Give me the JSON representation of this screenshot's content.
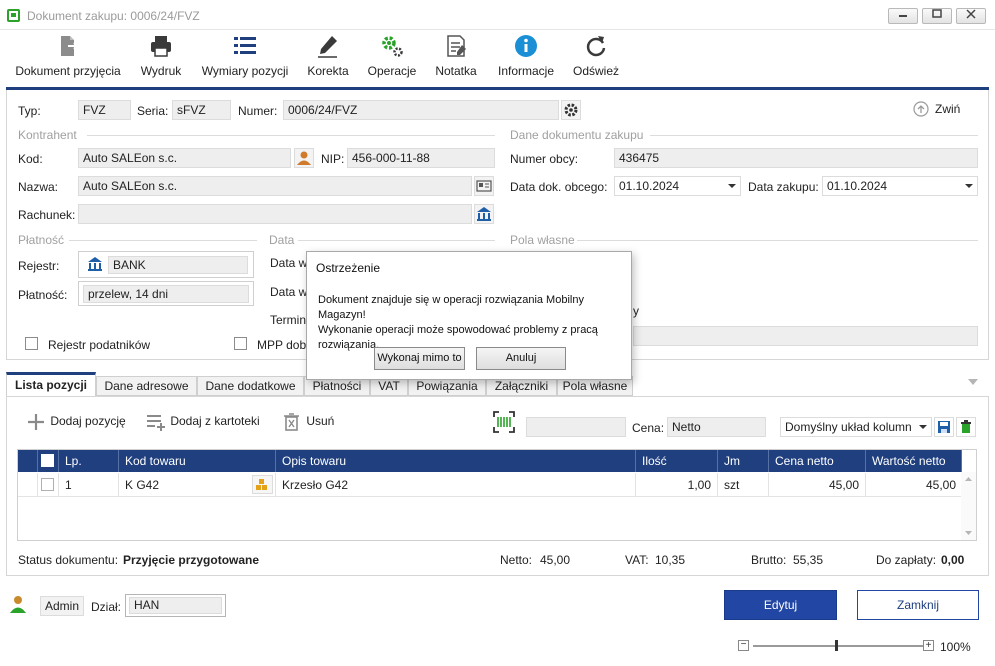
{
  "window": {
    "title": "Dokument zakupu: 0006/24/FVZ"
  },
  "toolbar": {
    "items": [
      {
        "label": "Dokument przyjęcia"
      },
      {
        "label": "Wydruk"
      },
      {
        "label": "Wymiary pozycji"
      },
      {
        "label": "Korekta"
      },
      {
        "label": "Operacje"
      },
      {
        "label": "Notatka"
      },
      {
        "label": "Informacje"
      },
      {
        "label": "Odśwież"
      }
    ]
  },
  "header": {
    "typ_label": "Typ:",
    "typ_value": "FVZ",
    "seria_label": "Seria:",
    "seria_value": "sFVZ",
    "numer_label": "Numer:",
    "numer_value": "0006/24/FVZ",
    "collapse_label": "Zwiń"
  },
  "kontrahent": {
    "section": "Kontrahent",
    "kod_label": "Kod:",
    "kod_value": "Auto SALEon s.c.",
    "nip_label": "NIP:",
    "nip_value": "456-000-11-88",
    "nazwa_label": "Nazwa:",
    "nazwa_value": "Auto SALEon s.c.",
    "rachunek_label": "Rachunek:",
    "rachunek_value": ""
  },
  "dane_dokumentu": {
    "section": "Dane dokumentu zakupu",
    "numer_obcy_label": "Numer obcy:",
    "numer_obcy_value": "436475",
    "data_dok_label": "Data dok. obcego:",
    "data_dok_value": "01.10.2024",
    "data_zakupu_label": "Data zakupu:",
    "data_zakupu_value": "01.10.2024"
  },
  "platnosc": {
    "section": "Płatność",
    "rejestr_label": "Rejestr:",
    "rejestr_value": "BANK",
    "platnosc_label": "Płatność:",
    "platnosc_value": "przelew, 14 dni",
    "rejestr_podatnikow_label": "Rejestr podatników"
  },
  "data_section": {
    "section": "Data",
    "row1_label": "Data w",
    "row2_label": "Data w",
    "termin_label": "Termin",
    "mpp_label": "MPP dob"
  },
  "pola_wlasne": {
    "section": "Pola własne",
    "partial_label": "y"
  },
  "tabs": [
    {
      "label": "Lista pozycji"
    },
    {
      "label": "Dane adresowe"
    },
    {
      "label": "Dane dodatkowe"
    },
    {
      "label": "Płatności"
    },
    {
      "label": "VAT"
    },
    {
      "label": "Powiązania"
    },
    {
      "label": "Załączniki"
    },
    {
      "label": "Pola własne"
    }
  ],
  "actions": {
    "add_position": "Dodaj pozycję",
    "add_from_catalog": "Dodaj z kartoteki",
    "remove": "Usuń",
    "cena_label": "Cena:",
    "cena_value": "Netto",
    "layout_value": "Domyślny układ kolumn"
  },
  "table": {
    "columns": [
      "Lp.",
      "Kod towaru",
      "Opis towaru",
      "Ilość",
      "Jm",
      "Cena netto",
      "Wartość netto"
    ],
    "rows": [
      {
        "lp": "1",
        "kod": "K G42",
        "opis": "Krzesło G42",
        "ilosc": "1,00",
        "jm": "szt",
        "cena": "45,00",
        "wartosc": "45,00"
      }
    ]
  },
  "summary": {
    "status_label": "Status dokumentu:",
    "status_value": "Przyjęcie przygotowane",
    "netto_label": "Netto:",
    "netto_value": "45,00",
    "vat_label": "VAT:",
    "vat_value": "10,35",
    "brutto_label": "Brutto:",
    "brutto_value": "55,35",
    "do_zaplaty_label": "Do zapłaty:",
    "do_zaplaty_value": "0,00"
  },
  "footer": {
    "user": "Admin",
    "dzial_label": "Dział:",
    "dzial_value": "HAN",
    "edit_button": "Edytuj",
    "close_button": "Zamknij",
    "zoom": "100%"
  },
  "dialog": {
    "title": "Ostrzeżenie",
    "line1": "Dokument znajduje się w operacji rozwiązania Mobilny Magazyn!",
    "line2": "Wykonanie operacji może spowodować problemy z pracą",
    "line3": "rozwiązania.",
    "confirm": "Wykonaj mimo to",
    "cancel": "Anuluj"
  },
  "colors": {
    "accent": "#1f3f7f",
    "primary_button": "#2146a3",
    "icon_green": "#2ba32b",
    "icon_blue": "#1a8fd6"
  }
}
